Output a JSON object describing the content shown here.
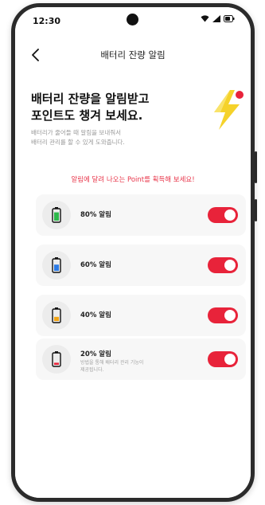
{
  "status_bar": {
    "time": "12:30"
  },
  "header": {
    "title": "배터리 잔량 알림"
  },
  "hero": {
    "title_line1": "배터리 잔량을 알림받고",
    "title_line2": "포인트도 챙겨 보세요.",
    "subtitle_line1": "배터리가 줄어들 때 알림을 보내줘서",
    "subtitle_line2": "배터리 관리를 할 수 있게 도와줍니다."
  },
  "banner": {
    "text": "알림에 달려 나오는 Point를 획득해 보세요!"
  },
  "alarms": [
    {
      "label": "80% 알림",
      "level": 0.8,
      "color": "#2eb84b",
      "enabled": true
    },
    {
      "label": "60% 알림",
      "level": 0.6,
      "color": "#2c7be5",
      "enabled": true
    },
    {
      "label": "40% 알림",
      "level": 0.4,
      "color": "#f2a516",
      "enabled": true
    },
    {
      "label": "20% 알림",
      "level": 0.2,
      "color": "#e8233a",
      "enabled": true,
      "desc_line1": "방법을 통해 배터리 관리 기능이",
      "desc_line2": "제공됩니다."
    }
  ],
  "colors": {
    "accent": "#e8233a",
    "banner_text": "#e8354a",
    "bolt": "#f5d22a"
  },
  "icons": {
    "back": "back-arrow-icon",
    "hero": "lightning-bolt-icon",
    "wifi": "wifi-icon",
    "signal": "signal-icon",
    "battery": "battery-icon"
  }
}
